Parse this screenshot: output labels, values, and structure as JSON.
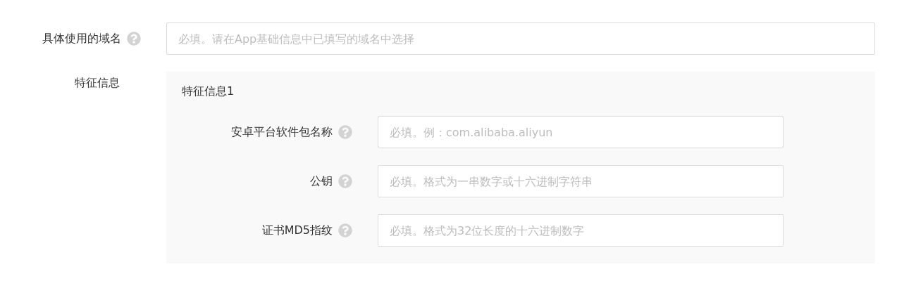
{
  "fields": [
    {
      "label": "具体使用的域名",
      "placeholder": "必填。请在App基础信息中已填写的域名中选择"
    }
  ],
  "feature_section": {
    "label": "特征信息",
    "groups": [
      {
        "title": "特征信息1",
        "fields": [
          {
            "label": "安卓平台软件包名称",
            "placeholder": "必填。例：com.alibaba.aliyun"
          },
          {
            "label": "公钥",
            "placeholder": "必填。格式为一串数字或十六进制字符串"
          },
          {
            "label": "证书MD5指纹",
            "placeholder": "必填。格式为32位长度的十六进制数字"
          }
        ]
      }
    ]
  }
}
